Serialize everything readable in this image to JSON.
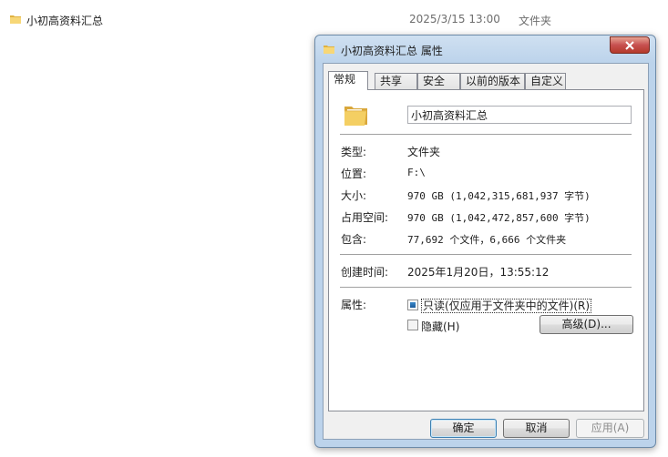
{
  "background_row": {
    "name": "小初高资料汇总",
    "date": "2025/3/15 13:00",
    "type": "文件夹"
  },
  "dialog": {
    "title": "小初高资料汇总 属性",
    "tabs": [
      "常规",
      "共享",
      "安全",
      "以前的版本",
      "自定义"
    ],
    "active_tab": "常规",
    "folder_name": "小初高资料汇总",
    "info": [
      {
        "label": "类型:",
        "value": "文件夹"
      },
      {
        "label": "位置:",
        "value": "F:\\"
      },
      {
        "label": "大小:",
        "value": "970 GB (1,042,315,681,937 字节)"
      },
      {
        "label": "占用空间:",
        "value": "970 GB (1,042,472,857,600 字节)"
      },
      {
        "label": "包含:",
        "value": "77,692 个文件，6,666 个文件夹"
      }
    ],
    "created": {
      "label": "创建时间:",
      "value": "2025年1月20日，13:55:12"
    },
    "attributes": {
      "label": "属性:",
      "readonly": "只读(仅应用于文件夹中的文件)(R)",
      "hidden": "隐藏(H)",
      "advanced": "高级(D)..."
    },
    "buttons": {
      "ok": "确定",
      "cancel": "取消",
      "apply": "应用(A)"
    }
  },
  "colors": {
    "title_bg": "#bcd3eb",
    "close_button": "#c75050",
    "checkbox_fill": "#1c5b9a"
  }
}
